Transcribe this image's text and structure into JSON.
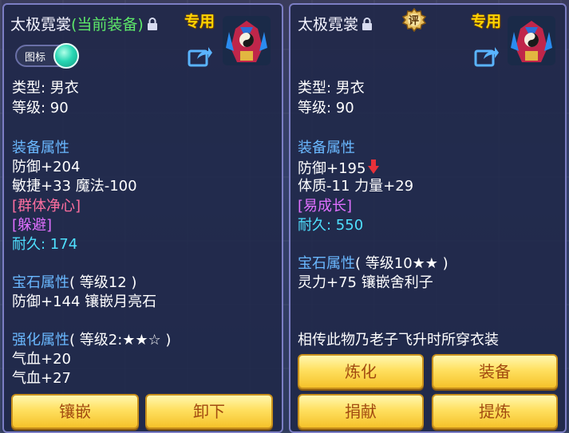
{
  "left": {
    "title": "太极霓裳",
    "current_tag": "(当前装备)",
    "exclusive": "专用",
    "toggle_label": "图标",
    "type_line": "类型: 男衣",
    "level_line": "等级: 90",
    "attr_header": "装备属性",
    "attr_lines": [
      "防御+204",
      "敏捷+33 魔法-100"
    ],
    "skill1": "[群体净心]",
    "skill2": "[躲避]",
    "durability_label": "耐久: ",
    "durability_value": "174",
    "gem_header": "宝石属性",
    "gem_level": "( 等级12 )",
    "gem_line": "防御+144 镶嵌月亮石",
    "enhance_header": "强化属性",
    "enhance_level": "( 等级2:★★☆ )",
    "enhance_lines": [
      "气血+20",
      "气血+27"
    ],
    "buttons": [
      "镶嵌",
      "卸下"
    ]
  },
  "right": {
    "title": "太极霓裳",
    "exclusive": "专用",
    "rating_badge": "评",
    "type_line": "类型: 男衣",
    "level_line": "等级: 90",
    "attr_header": "装备属性",
    "attr_line1": "防御+195",
    "attr_line2": "体质-11 力量+29",
    "skill1": "[易成长]",
    "durability_label": "耐久: ",
    "durability_value": "550",
    "gem_header": "宝石属性",
    "gem_level": "( 等级10★★ )",
    "gem_line": "灵力+75 镶嵌舍利子",
    "lore": "相传此物乃老子飞升时所穿衣装",
    "buttons": [
      "炼化",
      "装备",
      "捐献",
      "提炼"
    ]
  },
  "colors": {
    "title": "#f4f4ff",
    "current_tag": "#5de86a",
    "exclusive": "#ffd400",
    "section": "#6ab8ff",
    "skill": "#ff6fa0",
    "skill_alt": "#e070ff",
    "durability": "#4fe0ff",
    "button_text": "#a24a10"
  }
}
